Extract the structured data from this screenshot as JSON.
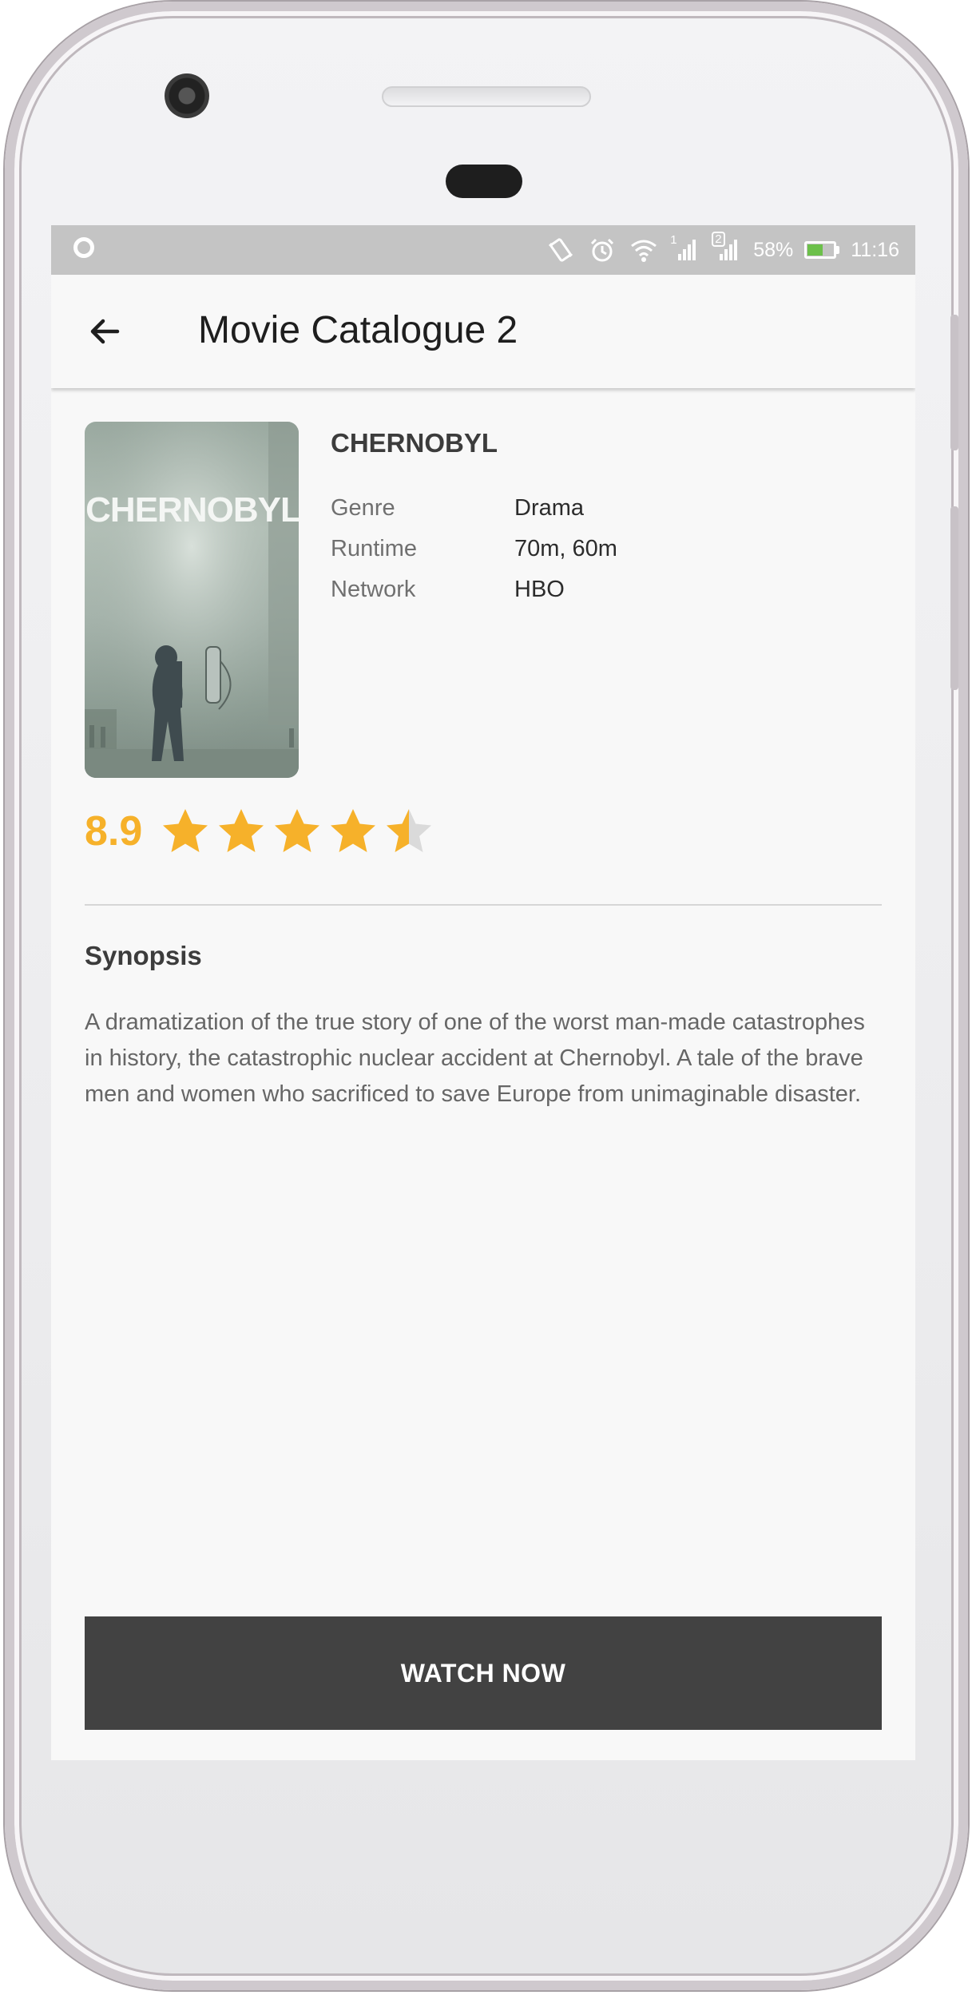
{
  "status_bar": {
    "battery_percent": "58%",
    "time": "11:16",
    "sim1_label": "1",
    "sim2_label": "2",
    "icons": [
      "notification-ring-icon",
      "vibrate-icon",
      "alarm-icon",
      "wifi-icon",
      "signal-sim1-icon",
      "signal-sim2-icon",
      "battery-charging-icon"
    ]
  },
  "app_bar": {
    "title": "Movie Catalogue 2",
    "back_icon": "arrow-left-icon"
  },
  "movie": {
    "title": "CHERNOBYL",
    "poster_text": "CHERNOBYL",
    "details": [
      {
        "label": "Genre",
        "value": "Drama"
      },
      {
        "label": "Runtime",
        "value": "70m, 60m"
      },
      {
        "label": "Network",
        "value": "HBO"
      }
    ],
    "rating": "8.9",
    "stars_filled": 4.5,
    "stars_total": 5
  },
  "synopsis": {
    "heading": "Synopsis",
    "text": "A dramatization of the true story of one of the worst man-made catastrophes in history, the catastrophic nuclear accident at Chernobyl. A tale of the brave men and women who sacrificed to save Europe from unimaginable disaster."
  },
  "actions": {
    "watch_label": "WATCH NOW"
  },
  "colors": {
    "accent": "#F6B12A",
    "star_empty": "#DADADA",
    "button_bg": "#424242",
    "status_bar_bg": "#C4C4C4",
    "battery_fill": "#6CC04A"
  }
}
